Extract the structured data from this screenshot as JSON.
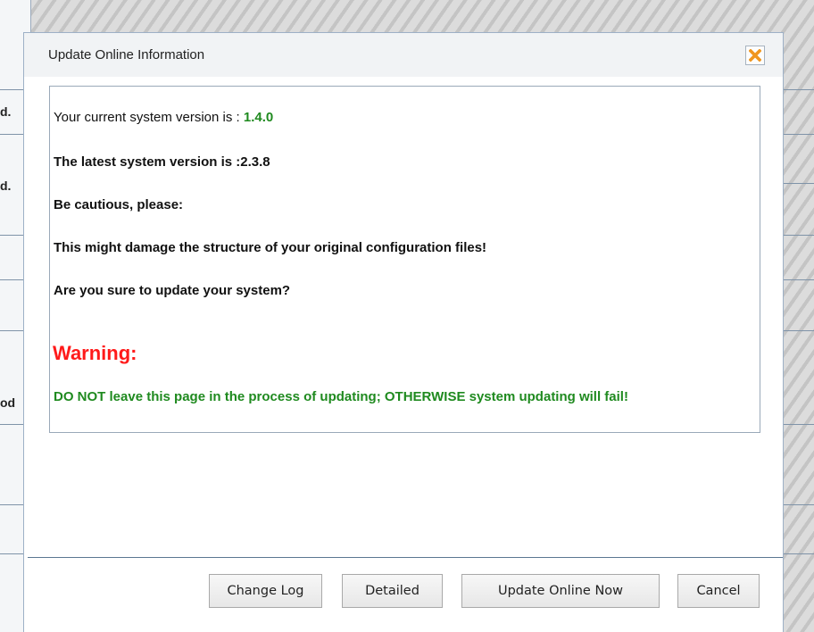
{
  "background": {
    "fragments": [
      "d.",
      "d.",
      "od"
    ]
  },
  "dialog": {
    "title": "Update Online Information",
    "close_icon": "close-x-icon",
    "current_version_label": "Your current system version is : ",
    "current_version_value": "1.4.0",
    "latest_version_text": "The latest system version is :2.3.8",
    "caution_text": "Be cautious, please:",
    "damage_text": "This might damage the structure of your original configuration files!",
    "confirm_text": "Are you sure to update your system?",
    "warning_title": "Warning:",
    "warning_message": "DO NOT leave this page in the process of updating; OTHERWISE system updating will fail!",
    "buttons": {
      "change_log": "Change Log",
      "detailed": "Detailed",
      "update_now": "Update Online Now",
      "cancel": "Cancel"
    }
  },
  "colors": {
    "version_green": "#1f8a1f",
    "warning_red": "#ff1a1a",
    "close_icon_orange": "#f0961e"
  }
}
